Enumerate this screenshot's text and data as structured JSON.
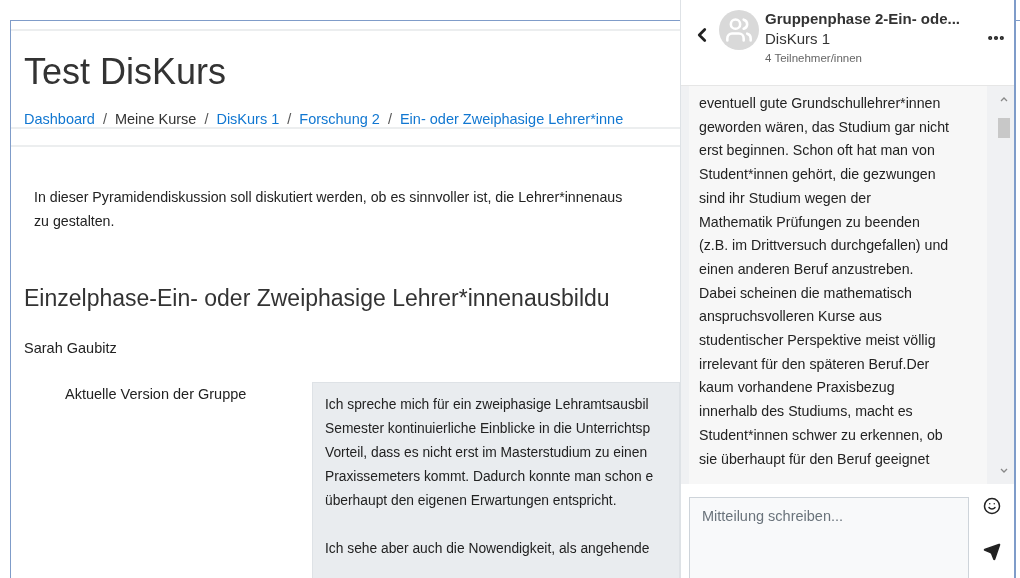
{
  "course": {
    "title": "Test DisKurs",
    "breadcrumb": [
      {
        "label": "Dashboard",
        "link": true
      },
      {
        "separator": "/",
        "label": "Meine Kurse",
        "link": false
      },
      {
        "separator": "/",
        "label": "DisKurs 1",
        "link": true
      },
      {
        "separator": "/",
        "label": "Forschung 2",
        "link": true
      },
      {
        "separator": "/",
        "label": "Ein- oder Zweiphasige Lehrer*inne",
        "link": true
      }
    ]
  },
  "intro": [
    "In dieser Pyramidendiskussion soll diskutiert werden, ob es sinnvoller ist, die Lehrer*innenaus",
    "zu gestalten."
  ],
  "section": {
    "heading": "Einzelphase-Ein- oder Zweiphasige Lehrer*innenausbildu",
    "author": "Sarah Gaubitz",
    "version_label": "Aktuelle Version der Gruppe",
    "version_paragraphs": [
      [
        "Ich spreche mich für ein zweiphasige Lehramtsausbil",
        "Semester kontinuierliche Einblicke in die Unterrichtsp",
        "Vorteil, dass es nicht erst im Masterstudium zu einen",
        "Praxissemeters kommt. Dadurch konnte man schon e",
        "überhaupt den eigenen Erwartungen entspricht."
      ],
      [
        "Ich sehe aber auch die Nowendigkeit, als angehende"
      ]
    ]
  },
  "chat": {
    "title": "Gruppenphase 2-Ein- ode...",
    "course": "DisKurs 1",
    "participants": "4 Teilnehmer/innen",
    "message_lines": [
      "eventuell gute Grundschullehrer*innen",
      "geworden wären, das Studium gar nicht",
      "erst beginnen. Schon oft hat man von",
      "Student*innen gehört, die gezwungen",
      "sind ihr Studium wegen der",
      "Mathematik Prüfungen zu beenden",
      "(z.B. im Drittversuch durchgefallen) und",
      "einen anderen Beruf anzustreben.",
      "Dabei scheinen die mathematisch",
      "anspruchsvolleren Kurse aus",
      "studentischer Perspektive meist völlig",
      "irrelevant für den späteren Beruf.Der",
      "kaum vorhandene Praxisbezug",
      "innerhalb des Studiums, macht es",
      "Student*innen schwer zu erkennen, ob",
      "sie überhaupt für den Beruf geeignet"
    ],
    "composer": {
      "placeholder": "Mitteilung schreiben..."
    }
  }
}
